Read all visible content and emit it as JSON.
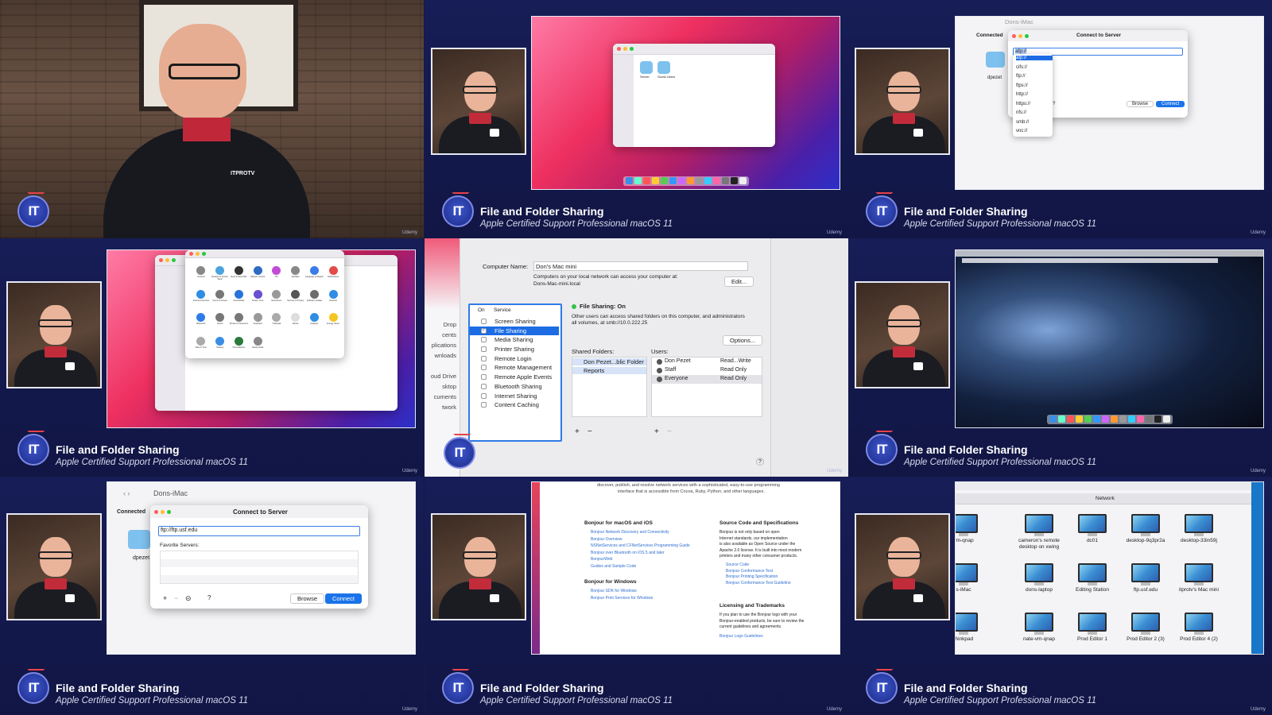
{
  "brand": {
    "logo_text": "IT",
    "watermark": "Udemy"
  },
  "course": {
    "title": "File and Folder Sharing",
    "subtitle": "Apple Certified Support Professional macOS 11"
  },
  "presenter": {
    "shirt_logo": "ITPROTV"
  },
  "connect_server": {
    "window_title": "Connect to Server",
    "finder_title": "Dons-iMac",
    "sidebar_label": "Connected",
    "folder_label": "dpezet",
    "protocol_value": "afp://",
    "protocols": [
      "afp://",
      "cifs://",
      "ftp://",
      "ftps://",
      "http://",
      "https://",
      "nfs://",
      "smb://",
      "vnc://"
    ],
    "browse": "Browse",
    "connect": "Connect",
    "help": "?",
    "address_value": "ftp://ftp.usf.edu",
    "favorites_label": "Favorite Servers:",
    "add": "+",
    "remove": "−",
    "more": "⊝"
  },
  "sharing": {
    "computer_name_label": "Computer Name:",
    "computer_name": "Don's Mac mini",
    "local_note_1": "Computers on your local network can access your computer at:",
    "local_note_2": "Dons-Mac-mini.local",
    "edit": "Edit...",
    "col_on": "On",
    "col_service": "Service",
    "services": [
      {
        "name": "Screen Sharing",
        "checked": false
      },
      {
        "name": "File Sharing",
        "checked": true
      },
      {
        "name": "Media Sharing",
        "checked": false
      },
      {
        "name": "Printer Sharing",
        "checked": false
      },
      {
        "name": "Remote Login",
        "checked": false
      },
      {
        "name": "Remote Management",
        "checked": false
      },
      {
        "name": "Remote Apple Events",
        "checked": false
      },
      {
        "name": "Bluetooth Sharing",
        "checked": false
      },
      {
        "name": "Internet Sharing",
        "checked": false
      },
      {
        "name": "Content Caching",
        "checked": false
      }
    ],
    "status": "File Sharing: On",
    "desc_1": "Other users can access shared folders on this computer, and administrators",
    "desc_2": "all volumes, at smb://10.0.222.25",
    "options": "Options...",
    "shared_folders_label": "Shared Folders:",
    "users_label": "Users:",
    "folders": [
      "Don Pezet...blic Folder",
      "Reports"
    ],
    "users": [
      {
        "name": "Don Pezet",
        "perm": "Read...Write"
      },
      {
        "name": "Staff",
        "perm": "Read Only"
      },
      {
        "name": "Everyone",
        "perm": "Read Only"
      }
    ],
    "side_items": [
      "Drop",
      "cents",
      "plications",
      "wnloads",
      "oud Drive",
      "sktop",
      "cuments",
      "twork"
    ],
    "help": "?"
  },
  "bonjour": {
    "intro_1": "discover, publish, and resolve network services with a sophisticated, easy-to-use programming",
    "intro_2": "interface that is accessible from Cocoa, Ruby, Python, and other languages.",
    "mac_heading": "Bonjour for macOS and iOS",
    "mac_links": [
      "Bonjour Network Discovery and Connectivity",
      "Bonjour Overview",
      "NSNetServices and CFNetServices Programming Guide",
      "Bonjour over Bluetooth on iOS 5 and later",
      "BonjourWeb",
      "Guides and Sample Code"
    ],
    "win_heading": "Bonjour for Windows",
    "win_links": [
      "Bonjour SDK for Windows",
      "Bonjour Print Services for Windows"
    ],
    "src_heading": "Source Code and Specifications",
    "src_text": [
      "Bonjour is not only based on open",
      "Internet standards, our implementation",
      "is also available as Open Source under the",
      "Apache 2.0 license. It is built into most modern",
      "printers and many other consumer products."
    ],
    "src_links": [
      "Source Code",
      "Bonjour Conformance Test",
      "Bonjour Printing Specification",
      "Bonjour Conformance Test Guideline"
    ],
    "lic_heading": "Licensing and Trademarks",
    "lic_text": [
      "If you plan to use the Bonjour logo with your",
      "Bonjour-enabled products, be sure to review the",
      "current guidelines and agreements."
    ],
    "lic_link": "Bonjour Logo Guidelines"
  },
  "network": {
    "title": "Network",
    "items": [
      "vm-qnap",
      "cameron's remote desktop on xwing",
      "dc01",
      "desktop-9q3pr2a",
      "desktop-33in59j",
      "s-iMac",
      "dons-laptop",
      "Editing Station",
      "ftp.usf.edu",
      "itprotv's Mac mini",
      "thinkpad",
      "nate-vm-qnap",
      "Prod Editor 1",
      "Prod Editor 2 (3)",
      "Prod Editor 4 (2)"
    ]
  },
  "finder_mini": {
    "folders": [
      "Server",
      "Guest Users"
    ]
  },
  "prefs_icons": [
    "General",
    "Desktop & Screen Saver",
    "Dock & Menu Bar",
    "Mission Control",
    "Siri",
    "Spotlight",
    "Language & Region",
    "Notifications",
    "Internet Accounts",
    "Users & Groups",
    "Accessibility",
    "Screen Time",
    "Extensions",
    "Security & Privacy",
    "Software Update",
    "Network",
    "Bluetooth",
    "Sound",
    "Printers & Scanners",
    "Keyboard",
    "Trackpad",
    "Mouse",
    "Displays",
    "Energy Saver",
    "Date & Time",
    "Sharing",
    "Time Machine",
    "Startup Disk"
  ],
  "colors": {
    "accent": "#1a73e8",
    "bg": "#141a4a",
    "selection": "#1d6ce4"
  }
}
